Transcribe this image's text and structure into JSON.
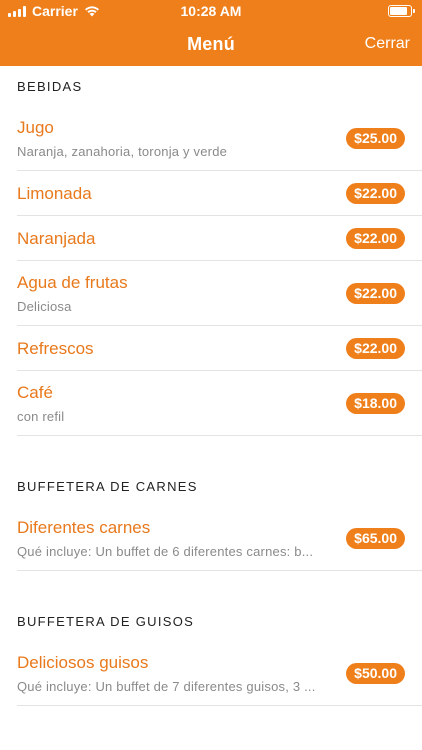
{
  "status_bar": {
    "carrier": "Carrier",
    "time": "10:28 AM"
  },
  "nav": {
    "title": "Menú",
    "close_label": "Cerrar"
  },
  "colors": {
    "accent": "#ef7f1a",
    "item_title": "#e8791c",
    "description": "#8a8a8a"
  },
  "sections": [
    {
      "title": "BEBIDAS",
      "items": [
        {
          "name": "Jugo",
          "description": "Naranja, zanahoria, toronja y verde",
          "price": "$25.00"
        },
        {
          "name": "Limonada",
          "description": "",
          "price": "$22.00"
        },
        {
          "name": "Naranjada",
          "description": "",
          "price": "$22.00"
        },
        {
          "name": "Agua de frutas",
          "description": "Deliciosa",
          "price": "$22.00"
        },
        {
          "name": "Refrescos",
          "description": "",
          "price": "$22.00"
        },
        {
          "name": "Café",
          "description": "con refil",
          "price": "$18.00"
        }
      ]
    },
    {
      "title": "BUFFETERA DE CARNES",
      "items": [
        {
          "name": "Diferentes carnes",
          "description": "Qué incluye: Un buffet de 6 diferentes carnes: b...",
          "price": "$65.00"
        }
      ]
    },
    {
      "title": "BUFFETERA DE GUISOS",
      "items": [
        {
          "name": "Deliciosos guisos",
          "description": "Qué incluye: Un buffet de 7 diferentes guisos, 3 ...",
          "price": "$50.00"
        }
      ]
    }
  ]
}
